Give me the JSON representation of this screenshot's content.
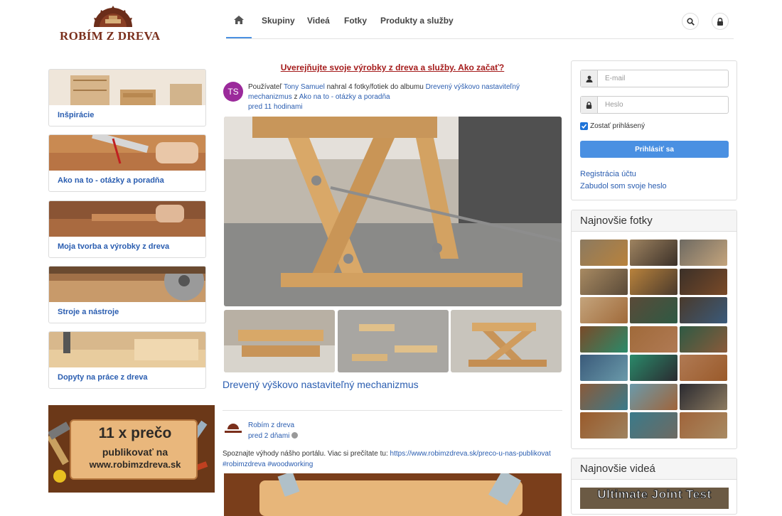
{
  "header": {
    "logo_text": "ROBÍM Z DREVA",
    "nav": [
      {
        "label": "Skupiny"
      },
      {
        "label": "Videá"
      },
      {
        "label": "Fotky"
      },
      {
        "label": "Produkty a služby"
      }
    ],
    "icons": {
      "home": "home-icon",
      "search": "search-icon",
      "lock": "lock-icon"
    }
  },
  "sidebar": {
    "categories": [
      {
        "label": "Inšpirácie"
      },
      {
        "label": "Ako na to - otázky a poradňa"
      },
      {
        "label": "Moja tvorba a výrobky z dreva"
      },
      {
        "label": "Stroje a nástroje"
      },
      {
        "label": "Dopyty na práce z dreva"
      }
    ],
    "banner": {
      "line1": "11 x prečo",
      "line2": "publikovať na",
      "line3": "www.robimzdreva.sk"
    }
  },
  "feed": {
    "headline": "Uverejňujte svoje výrobky z dreva a služby. Ako začať?",
    "post1": {
      "avatar_initials": "TS",
      "prefix": "Používateľ",
      "user": "Tony Samuel",
      "action": "nahral 4 fotky/fotiek do albumu",
      "album": "Drevený výškovo nastaviteľný mechanizmus",
      "connector": "z",
      "group": "Ako na to - otázky a poradňa",
      "time": "pred 11 hodinami",
      "album_title": "Drevený výškovo nastaviteľný mechanizmus"
    },
    "post2": {
      "author": "Robím z dreva",
      "time": "pred 2 dňami",
      "text": "Spoznajte výhody nášho portálu. Viac si prečítate tu:",
      "link": "https://www.robimzdreva.sk/preco-u-nas-publikovat",
      "tags": "#robimzdreva #woodworking"
    }
  },
  "login": {
    "email_placeholder": "E-mail",
    "password_placeholder": "Heslo",
    "remember_label": "Zostať prihlásený",
    "remember_checked": true,
    "submit_label": "Prihlásiť sa",
    "register_link": "Registrácia účtu",
    "forgot_link": "Zabudol som svoje heslo"
  },
  "latest_photos": {
    "title": "Najnovšie fotky",
    "count": 21,
    "colors": [
      "#8c7a60",
      "#9e8360",
      "#6e6a62",
      "#a88a62",
      "#b8823c",
      "#3b3028",
      "#c4a47c",
      "#5a4a38",
      "#4a3a2c",
      "#7a4a28",
      "#a06a3a",
      "#2e5a44",
      "#3a5a7a",
      "#2a8a6a",
      "#b07a54",
      "#8a5a3a",
      "#6a9aaa",
      "#2a2a30",
      "#9a5a2a",
      "#3a7a8a",
      "#a0643a"
    ]
  },
  "latest_videos": {
    "title": "Najnovšie videá",
    "first_video_title": "Ultimate Joint Test"
  },
  "colors": {
    "accent": "#4a90e2",
    "link": "#2a5db0",
    "headline": "#a51c1c",
    "brand": "#7a2f1c"
  }
}
